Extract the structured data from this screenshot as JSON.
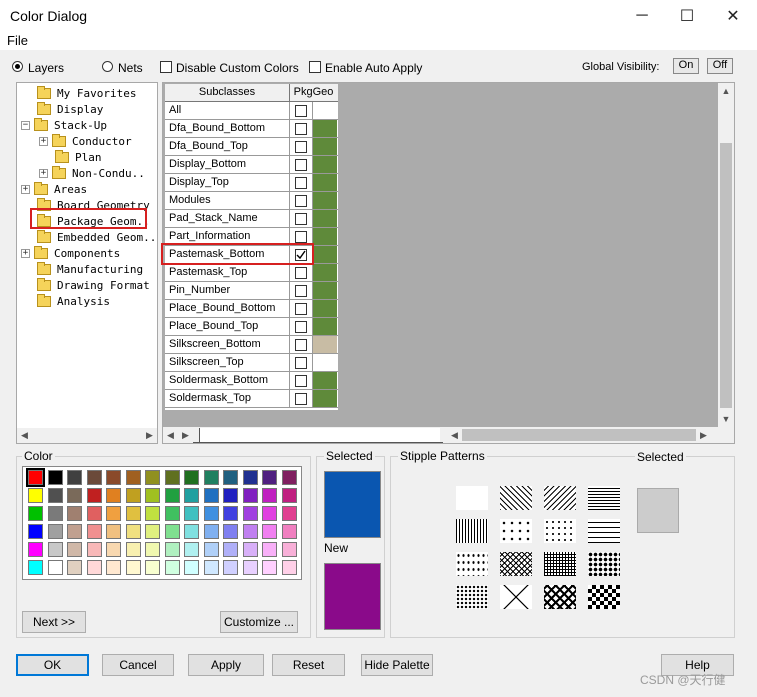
{
  "window": {
    "title": "Color Dialog",
    "minimize": "─",
    "maximize": "☐",
    "close": "✕"
  },
  "menu": {
    "file": "File"
  },
  "top": {
    "layers_label": "Layers",
    "nets_label": "Nets",
    "disable_custom_colors": "Disable Custom Colors",
    "enable_auto_apply": "Enable Auto Apply",
    "global_visibility": "Global Visibility:",
    "on": "On",
    "off": "Off"
  },
  "tree": [
    {
      "label": "My Favorites",
      "indent": 1,
      "expander": ""
    },
    {
      "label": "Display",
      "indent": 1,
      "expander": ""
    },
    {
      "label": "Stack-Up",
      "indent": 0,
      "expander": "−",
      "open": true
    },
    {
      "label": "Conductor",
      "indent": 2,
      "expander": "+"
    },
    {
      "label": "Plan",
      "indent": 3,
      "expander": ""
    },
    {
      "label": "Non-Condu..",
      "indent": 2,
      "expander": "+"
    },
    {
      "label": "Areas",
      "indent": 0,
      "expander": "+"
    },
    {
      "label": "Board Geometry",
      "indent": 1,
      "expander": ""
    },
    {
      "label": "Package Geom..",
      "indent": 1,
      "expander": "",
      "selected": true
    },
    {
      "label": "Embedded Geom..",
      "indent": 1,
      "expander": ""
    },
    {
      "label": "Components",
      "indent": 0,
      "expander": "+"
    },
    {
      "label": "Manufacturing",
      "indent": 1,
      "expander": ""
    },
    {
      "label": "Drawing Format",
      "indent": 1,
      "expander": ""
    },
    {
      "label": "Analysis",
      "indent": 1,
      "expander": ""
    }
  ],
  "grid": {
    "header_subclasses": "Subclasses",
    "header_col": "PkgGeo",
    "rows": [
      {
        "name": "All",
        "checked": false,
        "color": "#ffffff"
      },
      {
        "name": "Dfa_Bound_Bottom",
        "checked": false,
        "color": "#5f8a3a"
      },
      {
        "name": "Dfa_Bound_Top",
        "checked": false,
        "color": "#5f8a3a"
      },
      {
        "name": "Display_Bottom",
        "checked": false,
        "color": "#5f8a3a"
      },
      {
        "name": "Display_Top",
        "checked": false,
        "color": "#5f8a3a"
      },
      {
        "name": "Modules",
        "checked": false,
        "color": "#5f8a3a"
      },
      {
        "name": "Pad_Stack_Name",
        "checked": false,
        "color": "#5f8a3a"
      },
      {
        "name": "Part_Information",
        "checked": false,
        "color": "#5f8a3a"
      },
      {
        "name": "Pastemask_Bottom",
        "checked": true,
        "color": "#5f8a3a"
      },
      {
        "name": "Pastemask_Top",
        "checked": false,
        "color": "#5f8a3a"
      },
      {
        "name": "Pin_Number",
        "checked": false,
        "color": "#5f8a3a"
      },
      {
        "name": "Place_Bound_Bottom",
        "checked": false,
        "color": "#5f8a3a"
      },
      {
        "name": "Place_Bound_Top",
        "checked": false,
        "color": "#5f8a3a"
      },
      {
        "name": "Silkscreen_Bottom",
        "checked": false,
        "color": "#c8bca4"
      },
      {
        "name": "Silkscreen_Top",
        "checked": false,
        "color": "#ffffff"
      },
      {
        "name": "Soldermask_Bottom",
        "checked": false,
        "color": "#5f8a3a"
      },
      {
        "name": "Soldermask_Top",
        "checked": false,
        "color": "#5f8a3a"
      }
    ]
  },
  "color_section": {
    "label": "Color",
    "next": "Next >>",
    "customize": "Customize ...",
    "palette": [
      [
        "#ff0000",
        "#000000",
        "#404040",
        "#6b4a3a",
        "#8a4a2a",
        "#a06020",
        "#909020",
        "#607020",
        "#207020",
        "#208060",
        "#206080",
        "#203090",
        "#502080",
        "#802060"
      ],
      [
        "#ffff00",
        "#505050",
        "#7a6a5a",
        "#c02020",
        "#e08020",
        "#c0a020",
        "#a0c020",
        "#20a040",
        "#20a0a0",
        "#2070c0",
        "#2020c0",
        "#8020c0",
        "#c020c0",
        "#c02080"
      ],
      [
        "#00c000",
        "#7a7a7a",
        "#a08070",
        "#e06060",
        "#f0a040",
        "#e0c040",
        "#c0e040",
        "#40c060",
        "#40c0c0",
        "#4090e0",
        "#4040e0",
        "#a040e0",
        "#e040e0",
        "#e04090"
      ],
      [
        "#0000ff",
        "#a0a0a0",
        "#c0a090",
        "#f09090",
        "#f0c080",
        "#f0e080",
        "#e0f080",
        "#80e090",
        "#80e0e0",
        "#80b0f0",
        "#8080f0",
        "#c080f0",
        "#f080f0",
        "#f080c0"
      ],
      [
        "#ff00ff",
        "#c8c8c8",
        "#d0b8a8",
        "#f8b8b8",
        "#f8d8b0",
        "#f8f0b0",
        "#f0f8b0",
        "#b0f0c0",
        "#b0f0f0",
        "#b0d0f8",
        "#b0b0f8",
        "#d8b0f8",
        "#f8b0f8",
        "#f8b0d8"
      ],
      [
        "#00ffff",
        "#ffffff",
        "#e0d0c0",
        "#ffd8d8",
        "#ffe8d0",
        "#fff8d0",
        "#f8ffd0",
        "#d0ffe0",
        "#d0ffff",
        "#d0e8ff",
        "#d0d0ff",
        "#e8d0ff",
        "#ffd0ff",
        "#ffd0e8"
      ]
    ]
  },
  "selected_section": {
    "selected_label": "Selected",
    "selected_color": "#0a56b0",
    "new_label": "New",
    "new_color": "#8a0a8a"
  },
  "stipple": {
    "label": "Stipple Patterns",
    "selected_label": "Selected",
    "selected_color": "#cccccc"
  },
  "buttons": {
    "ok": "OK",
    "cancel": "Cancel",
    "apply": "Apply",
    "reset": "Reset",
    "hide_palette": "Hide Palette",
    "help": "Help"
  },
  "watermark": "CSDN @天行健"
}
